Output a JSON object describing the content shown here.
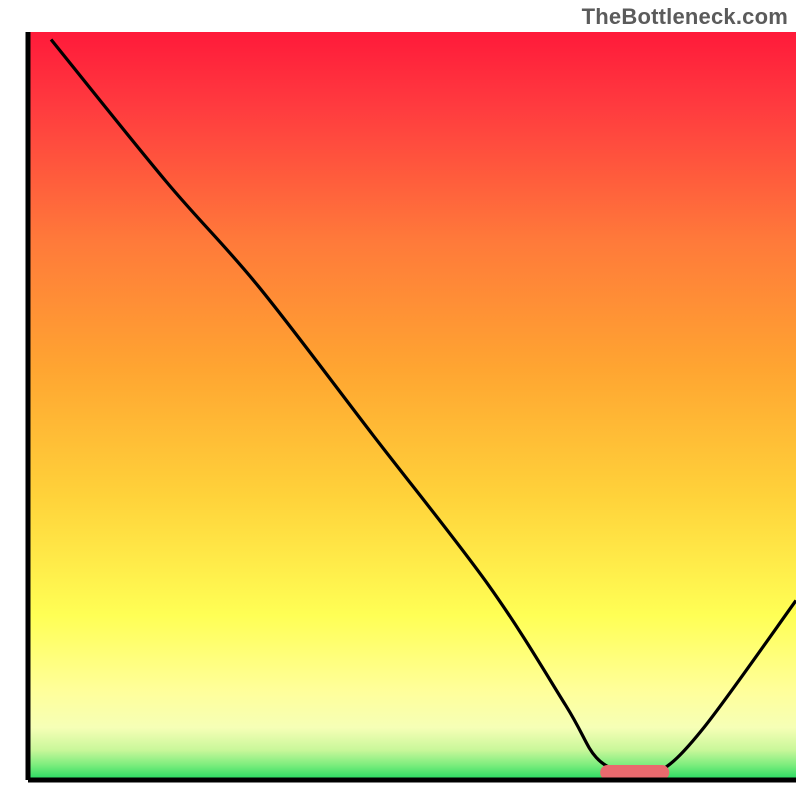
{
  "attribution": "TheBottleneck.com",
  "colors": {
    "top_red": "#ff1a3a",
    "mid_orange": "#ffa531",
    "low_yellow": "#ffff55",
    "pale_yellow": "#ffffb0",
    "green": "#22d960",
    "line": "#000000",
    "marker": "#e96a6e",
    "border": "#000000",
    "attribution_text": "#5b5b5b"
  },
  "chart_data": {
    "type": "line",
    "title": "",
    "xlabel": "",
    "ylabel": "",
    "xlim": [
      0,
      100
    ],
    "ylim": [
      0,
      100
    ],
    "grid": false,
    "legend": false,
    "series": [
      {
        "name": "bottleneck-curve",
        "x": [
          3,
          18,
          30,
          45,
          60,
          70,
          74,
          78,
          82,
          88,
          100
        ],
        "values": [
          99,
          80,
          66,
          46,
          26,
          10,
          3,
          1,
          1,
          7,
          24
        ]
      }
    ],
    "marker": {
      "name": "optimal-marker",
      "x": 79,
      "y": 1,
      "width_pct": 9,
      "height_pct": 2
    },
    "background_bands": [
      {
        "from_pct": 0,
        "to_pct": 50,
        "color_top": "#ff1a3a",
        "color_bottom": "#ffa531"
      },
      {
        "from_pct": 50,
        "to_pct": 80,
        "color_top": "#ffa531",
        "color_bottom": "#ffff55"
      },
      {
        "from_pct": 80,
        "to_pct": 93,
        "color_top": "#ffff55",
        "color_bottom": "#ffffb0"
      },
      {
        "from_pct": 93,
        "to_pct": 100,
        "color_top": "#ffffb0",
        "color_bottom": "#22d960"
      }
    ]
  }
}
